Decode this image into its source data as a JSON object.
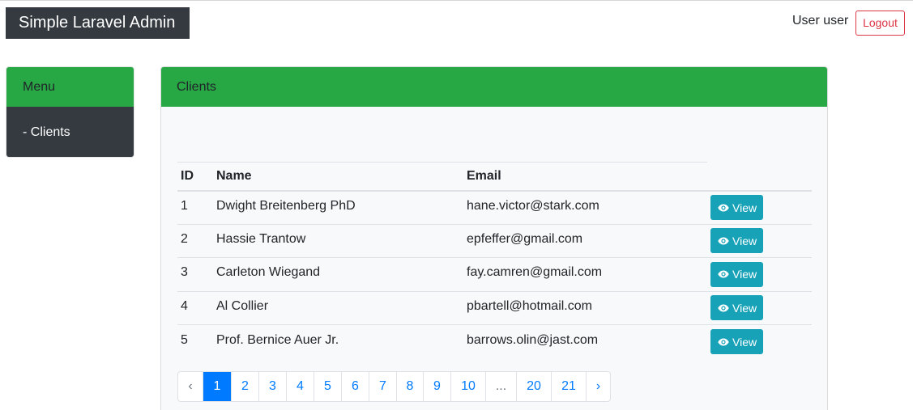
{
  "app": {
    "brand": "Simple Laravel Admin",
    "user_label": "User user",
    "logout_label": "Logout"
  },
  "sidebar": {
    "title": "Menu",
    "items": [
      {
        "label": "- Clients"
      }
    ]
  },
  "clients": {
    "title": "Clients",
    "columns": [
      "ID",
      "Name",
      "Email"
    ],
    "view_label": "View",
    "rows": [
      {
        "id": "1",
        "name": "Dwight Breitenberg PhD",
        "email": "hane.victor@stark.com"
      },
      {
        "id": "2",
        "name": "Hassie Trantow",
        "email": "epfeffer@gmail.com"
      },
      {
        "id": "3",
        "name": "Carleton Wiegand",
        "email": "fay.camren@gmail.com"
      },
      {
        "id": "4",
        "name": "Al Collier",
        "email": "pbartell@hotmail.com"
      },
      {
        "id": "5",
        "name": "Prof. Bernice Auer Jr.",
        "email": "barrows.olin@jast.com"
      }
    ]
  },
  "pagination": {
    "prev": "‹",
    "next": "›",
    "ellipsis": "...",
    "pages": [
      "1",
      "2",
      "3",
      "4",
      "5",
      "6",
      "7",
      "8",
      "9",
      "10",
      "20",
      "21"
    ],
    "current": "1"
  },
  "colors": {
    "brand_bg": "#343a40",
    "card_header": "#28a745",
    "view_button": "#17a2b8",
    "logout_border": "#dc3545",
    "page_active": "#007bff"
  },
  "icons": {
    "view": "eye-icon"
  }
}
